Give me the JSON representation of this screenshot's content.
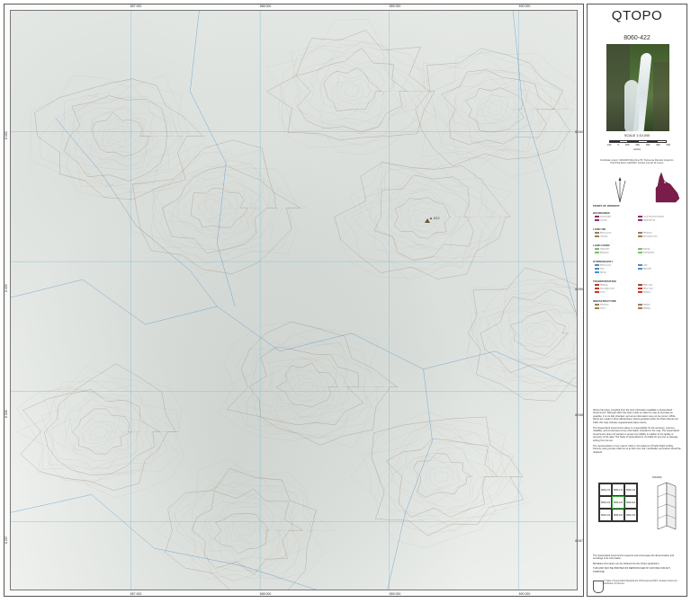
{
  "sheet": {
    "title": "QTOPO",
    "number": "8060-422"
  },
  "scale": {
    "label": "SCALE 1:10,000",
    "ticks": [
      "100",
      "0",
      "100",
      "200",
      "300",
      "400",
      "500"
    ],
    "unit": "metres"
  },
  "projection": {
    "text": "Coordinate system: GDA2020 MGA Zone 55. Transverse Mercator projection. Horizontal datum GDA2020. Contour interval 10 metres."
  },
  "grid": {
    "top_labels": [
      "587 000",
      "588 000",
      "589 000",
      "590 000",
      "591 000"
    ],
    "bottom_labels": [
      "587 000",
      "588 000",
      "589 000",
      "590 000",
      "591 000"
    ],
    "left_labels": [
      "8 060",
      "8 059",
      "8 058",
      "8 057"
    ],
    "right_labels": [
      "8 060",
      "8 059",
      "8 058",
      "8 057"
    ]
  },
  "map": {
    "peak_label": "▲ 612"
  },
  "legend": {
    "heading": "POINTS OF INTEREST",
    "sections": [
      {
        "title": "BOUNDARIES",
        "items": [
          "State border",
          "Local Government Area",
          "Locality",
          "National Park"
        ]
      },
      {
        "title": "LAND USE",
        "items": [
          "Built-up area",
          "Plantation",
          "Orchard",
          "Recreation area"
        ]
      },
      {
        "title": "LAND COVER",
        "items": [
          "Vegetation",
          "Swamp",
          "Mangrove",
          "Intertidal flat"
        ]
      },
      {
        "title": "HYDROGRAPHY",
        "items": [
          "Watercourse",
          "Lake",
          "Dam",
          "Waterfall",
          "Spring"
        ]
      },
      {
        "title": "TRANSPORTATION",
        "items": [
          "Highway",
          "Main road",
          "Secondary road",
          "Minor road",
          "Track",
          "Railway"
        ]
      },
      {
        "title": "INFRASTRUCTURE",
        "items": [
          "Powerline",
          "Pipeline",
          "Tower",
          "Building"
        ]
      }
    ],
    "colors": {
      "watercourse": "#4a90c8",
      "road": "#c0392b",
      "vegetation": "#7fbf6a",
      "boundary": "#8b2e6e",
      "contour": "#9c7f5a"
    }
  },
  "disclaimer": {
    "p1": "QTopo has been compiled from the best information available to Queensland Government. Although effort has been made to make the map as accurate as possible, it is not fully checked, and some information may not be current. While efforts are made to show official place names gazetted under the Place Names Act 1994, this map includes unguaranteed place names.",
    "p2": "The Queensland Government takes no responsibility for the accuracy, currency, reliability, and correctness of any information included on the map. The Queensland Government does not warrant or accept any liability in relation to the quality or accuracy of the data. The State of Queensland is not liable for any loss or damage arising from its use.",
    "p3": "The representation of any road or track is not evidence of Public Right of Way. Persons using private roads do so at their own risk. Landholder permission should be obtained."
  },
  "adjoining_sheets": [
    "8060-131",
    "8060-141",
    "8060-142",
    "8060-413",
    "8060-422",
    "8060-423",
    "8060-414",
    "8060-424",
    "8060-432"
  ],
  "fold_label": "FOLDING",
  "footer": {
    "p1": "The Queensland Government supports and encourages the dissemination and exchange of its information.",
    "p2": "Metadata information can be obtained via the QTopo application.",
    "p3": "THIS MAP MAY BE PRINTED OR REPRODUCED BY ANYONE FOR ANY PURPOSE.",
    "copyright": "© State of Queensland (Department of Resources) 2023. Creative Commons Attribution 4.0 licence."
  }
}
